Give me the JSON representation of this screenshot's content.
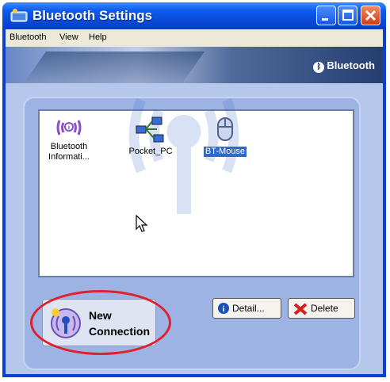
{
  "window": {
    "title": "Bluetooth Settings",
    "icon": "bluetooth-settings-icon",
    "controls": [
      "minimize-icon",
      "maximize-icon",
      "close-icon"
    ]
  },
  "menubar": {
    "items": [
      {
        "label": "Bluetooth"
      },
      {
        "label": "View"
      },
      {
        "label": "Help"
      }
    ]
  },
  "banner": {
    "brand": "Bluetooth"
  },
  "devices": [
    {
      "label": "Bluetooth Informati...",
      "icon": "bluetooth-information-icon",
      "selected": false
    },
    {
      "label": "Pocket_PC",
      "icon": "network-computers-icon",
      "selected": false
    },
    {
      "label": "BT-Mouse",
      "icon": "mouse-icon",
      "selected": true
    }
  ],
  "buttons": {
    "new_connection_line1": "New",
    "new_connection_line2": "Connection",
    "detail": "Detail...",
    "delete": "Delete"
  },
  "colors": {
    "title_bar": "#0a49d6",
    "selection": "#3168c6",
    "highlight_ring": "#e0202a",
    "panel": "#9db3e4"
  }
}
